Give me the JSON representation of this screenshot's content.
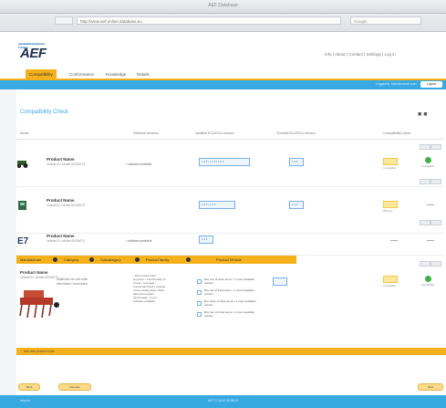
{
  "window": {
    "title": "AEF Database"
  },
  "browser": {
    "url": "http://www.aef-online.database.eu",
    "search_placeholder": "Google"
  },
  "brand": {
    "logo": "AEF",
    "logo_small": "agricultural industry electronics foundation"
  },
  "topnav": {
    "links": "Info | About | Contact | Settings | Log in"
  },
  "tabs": [
    {
      "label": "Compatibility"
    },
    {
      "label": "Conformance"
    },
    {
      "label": "Knowledge"
    },
    {
      "label": "Details"
    }
  ],
  "login": {
    "text": "Logged in: Maintenance user",
    "button": "Logout"
  },
  "page": {
    "title": "Compatibility Check"
  },
  "columns": [
    "Model",
    "Software versions",
    "Installed ECU/ECU-Version",
    "Terminal ECU/ECU-Version",
    "Compatibility check"
  ],
  "rows": [
    {
      "name": "Product Name",
      "sub": "Vehicle-ID • Model-ID/200073",
      "status": "• software available",
      "sel1": "1.0 ▾ | 2.1 ▾ | 2.0 ▾",
      "sel2": "1.0 ▾",
      "result": "Compatible"
    },
    {
      "name": "Product Name",
      "sub": "Vehicle-ID • Model-ID/200073",
      "status": "",
      "sel1": "2.0 ▾ | 1.0 ▾",
      "sel2": "1.0 ▾",
      "result": "Warning"
    },
    {
      "name": "Product Name",
      "sub": "Vehicle-ID • Model-ID/200073",
      "status": "• software available",
      "sel1": "1.0 ▾",
      "sel2": "",
      "result": ""
    }
  ],
  "breadcrumb": [
    "Manufacturer",
    "Category",
    "Subcategory",
    "Product family",
    "Product Vehicle"
  ],
  "expanded": {
    "name": "Product Name",
    "sub": "Vehicle-ID • Model-ID/200073",
    "desc": "Additional info and other information / description",
    "features": "• This product also supports: • Functionality of a new • coverage • Functional check • request of any setting data • More data and request functionality • more • software available",
    "options": [
      {
        "label": "Box one of three items • 1 more available options"
      },
      {
        "label": "Box two of three items • 1 more available options"
      },
      {
        "label": "Box three of three items • 1 more available options"
      },
      {
        "label": "Box four of three items • 1 more available options"
      }
    ],
    "badge": "Compatible"
  },
  "bottom_bar": {
    "text": "Add new product to list"
  },
  "buttons": {
    "back": "Back",
    "compare": "Compare",
    "next": "Next"
  },
  "footer": {
    "left": "Imprint",
    "center": "AEF © 2010 ISOBUS"
  },
  "colors": {
    "accent_orange": "#f5b11c",
    "accent_blue": "#39a9e2"
  }
}
